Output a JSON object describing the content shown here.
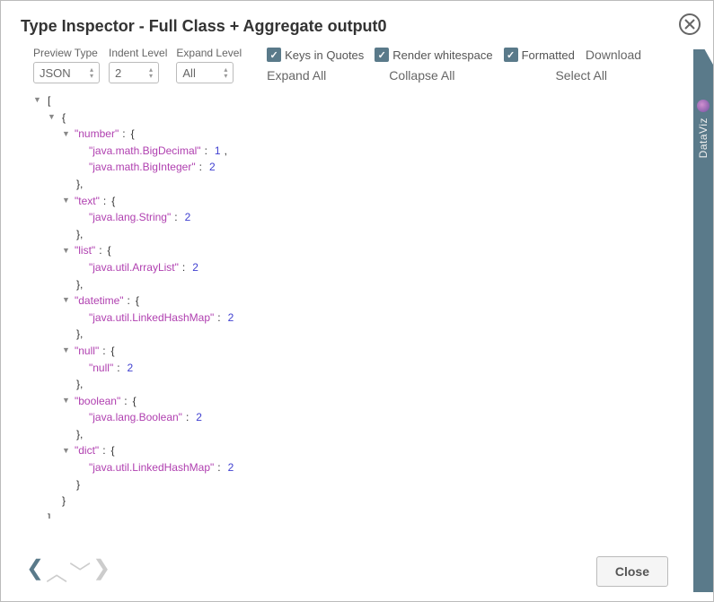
{
  "title": "Type Inspector - Full Class + Aggregate output0",
  "controls": {
    "previewTypeLabel": "Preview Type",
    "previewTypeValue": "JSON",
    "indentLevelLabel": "Indent Level",
    "indentLevelValue": "2",
    "expandLevelLabel": "Expand Level",
    "expandLevelValue": "All",
    "keysInQuotes": "Keys in Quotes",
    "renderWhitespace": "Render whitespace",
    "formatted": "Formatted",
    "download": "Download",
    "expandAll": "Expand All",
    "collapseAll": "Collapse All",
    "selectAll": "Select All"
  },
  "json": {
    "sections": [
      {
        "key": "\"number\"",
        "items": [
          {
            "k": "\"java.math.BigDecimal\"",
            "v": "1",
            "comma": true
          },
          {
            "k": "\"java.math.BigInteger\"",
            "v": "2",
            "comma": false
          }
        ]
      },
      {
        "key": "\"text\"",
        "items": [
          {
            "k": "\"java.lang.String\"",
            "v": "2",
            "comma": false
          }
        ]
      },
      {
        "key": "\"list\"",
        "items": [
          {
            "k": "\"java.util.ArrayList\"",
            "v": "2",
            "comma": false
          }
        ]
      },
      {
        "key": "\"datetime\"",
        "items": [
          {
            "k": "\"java.util.LinkedHashMap\"",
            "v": "2",
            "comma": false
          }
        ]
      },
      {
        "key": "\"null\"",
        "items": [
          {
            "k": "\"null\"",
            "v": "2",
            "comma": false
          }
        ]
      },
      {
        "key": "\"boolean\"",
        "items": [
          {
            "k": "\"java.lang.Boolean\"",
            "v": "2",
            "comma": false
          }
        ]
      },
      {
        "key": "\"dict\"",
        "items": [
          {
            "k": "\"java.util.LinkedHashMap\"",
            "v": "2",
            "comma": false
          }
        ]
      }
    ]
  },
  "footer": {
    "close": "Close"
  },
  "sideTab": "DataViz"
}
